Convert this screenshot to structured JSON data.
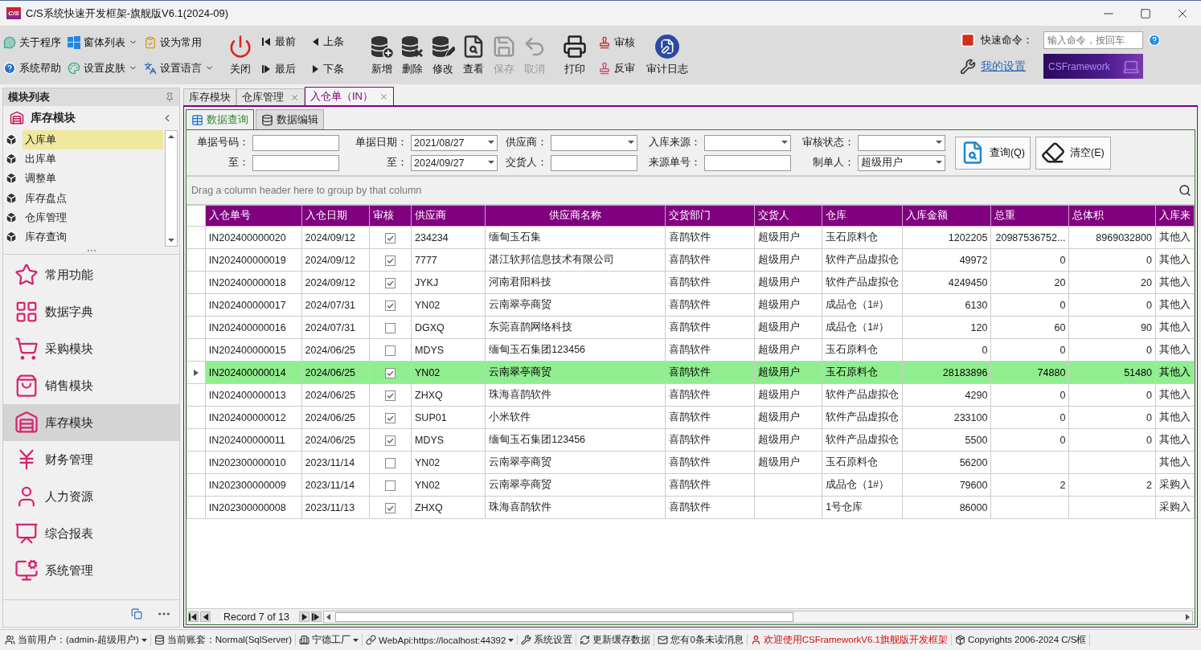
{
  "window": {
    "logo": "C/S",
    "title": "C/S系统快速开发框架-旗舰版V6.1(2024-09)"
  },
  "ribbon": {
    "quick_buttons": [
      {
        "label": "关于程序",
        "dropdown": false
      },
      {
        "label": "窗体列表",
        "dropdown": true
      },
      {
        "label": "设为常用",
        "dropdown": false
      },
      {
        "label": "系统帮助",
        "dropdown": false
      },
      {
        "label": "设置皮肤",
        "dropdown": true
      },
      {
        "label": "设置语言",
        "dropdown": true
      }
    ],
    "close_button": "关闭",
    "nav_buttons": [
      "最前",
      "上条",
      "最后",
      "下条"
    ],
    "action_buttons": [
      {
        "label": "新增",
        "disabled": false
      },
      {
        "label": "删除",
        "disabled": false
      },
      {
        "label": "修改",
        "disabled": false
      },
      {
        "label": "查看",
        "disabled": false
      },
      {
        "label": "保存",
        "disabled": true
      },
      {
        "label": "取消",
        "disabled": true
      },
      {
        "label": "打印",
        "disabled": false
      }
    ],
    "audit_buttons": [
      "审核",
      "反审"
    ],
    "log_button": "审计日志",
    "quick_command": {
      "label": "快速命令：",
      "placeholder": "输入命令，按回车"
    },
    "settings_link": "我的设置",
    "banner": "CSFramework"
  },
  "module_panel": {
    "title": "模块列表",
    "module": "库存模块",
    "items": [
      {
        "label": "入库单",
        "selected": true
      },
      {
        "label": "出库单",
        "selected": false
      },
      {
        "label": "调整单",
        "selected": false
      },
      {
        "label": "库存盘点",
        "selected": false
      },
      {
        "label": "仓库管理",
        "selected": false
      },
      {
        "label": "库存查询",
        "selected": false
      }
    ],
    "groups": [
      {
        "label": "常用功能",
        "selected": false
      },
      {
        "label": "数据字典",
        "selected": false
      },
      {
        "label": "采购模块",
        "selected": false
      },
      {
        "label": "销售模块",
        "selected": false
      },
      {
        "label": "库存模块",
        "selected": true
      },
      {
        "label": "财务管理",
        "selected": false
      },
      {
        "label": "人力资源",
        "selected": false
      },
      {
        "label": "综合报表",
        "selected": false
      },
      {
        "label": "系统管理",
        "selected": false
      }
    ]
  },
  "document_tabs": [
    {
      "label": "库存模块",
      "closable": false,
      "selected": false
    },
    {
      "label": "仓库管理",
      "closable": true,
      "selected": false
    },
    {
      "label": "入仓单（IN）",
      "closable": true,
      "selected": true
    }
  ],
  "view_tabs": [
    {
      "label": "数据查询",
      "selected": true
    },
    {
      "label": "数据编辑",
      "selected": false
    }
  ],
  "filters": [
    {
      "label": "单据号码：",
      "kind": "text"
    },
    {
      "label": "单据日期：",
      "kind": "dropdown",
      "value": "2021/08/27"
    },
    {
      "label": "供应商：",
      "kind": "dropdown"
    },
    {
      "label": "入库来源：",
      "kind": "dropdown"
    },
    {
      "label": "审核状态：",
      "kind": "dropdown"
    },
    {
      "label": "至：",
      "kind": "text"
    },
    {
      "label": "至：",
      "kind": "dropdown",
      "value": "2024/09/27"
    },
    {
      "label": "交货人：",
      "kind": "text"
    },
    {
      "label": "来源单号：",
      "kind": "text"
    },
    {
      "label": "制单人：",
      "kind": "dropdown",
      "value": "超级用户"
    }
  ],
  "filter_buttons": [
    "查询(Q)",
    "清空(E)"
  ],
  "group_panel_hint": "Drag a column header here to group by that column",
  "table": {
    "columns": [
      {
        "label": "入仓单号",
        "kind": "text"
      },
      {
        "label": "入仓日期",
        "kind": "text"
      },
      {
        "label": "审核",
        "kind": "check"
      },
      {
        "label": "供应商",
        "kind": "text"
      },
      {
        "label": "供应商名称",
        "kind": "text"
      },
      {
        "label": "交货部门",
        "kind": "text"
      },
      {
        "label": "交货人",
        "kind": "text"
      },
      {
        "label": "仓库",
        "kind": "text"
      },
      {
        "label": "入库金额",
        "kind": "number"
      },
      {
        "label": "总重",
        "kind": "number"
      },
      {
        "label": "总体积",
        "kind": "number"
      },
      {
        "label": "入库来",
        "kind": "text"
      }
    ],
    "rows": [
      {
        "selected": false,
        "cells": [
          "IN202400000020",
          "2024/09/12",
          true,
          "234234",
          "缅甸玉石集",
          "喜鹊软件",
          "超级用户",
          "玉石原料仓",
          "1202205",
          "20987536752...",
          "8969032800",
          "其他入"
        ]
      },
      {
        "selected": false,
        "cells": [
          "IN202400000019",
          "2024/09/12",
          true,
          "7777",
          "湛江软邦信息技术有限公司",
          "喜鹊软件",
          "超级用户",
          "软件产品虚拟仓",
          "49972",
          "0",
          "0",
          "其他入"
        ]
      },
      {
        "selected": false,
        "cells": [
          "IN202400000018",
          "2024/09/12",
          true,
          "JYKJ",
          "河南君阳科技",
          "喜鹊软件",
          "超级用户",
          "软件产品虚拟仓",
          "4249450",
          "20",
          "20",
          "其他入"
        ]
      },
      {
        "selected": false,
        "cells": [
          "IN202400000017",
          "2024/07/31",
          true,
          "YN02",
          "云南翠亭商贸",
          "喜鹊软件",
          "超级用户",
          "成品仓（1#）",
          "6130",
          "0",
          "0",
          "其他入"
        ]
      },
      {
        "selected": false,
        "cells": [
          "IN202400000016",
          "2024/07/31",
          false,
          "DGXQ",
          "东莞喜鹊网络科技",
          "喜鹊软件",
          "超级用户",
          "成品仓（1#）",
          "120",
          "60",
          "90",
          "其他入"
        ]
      },
      {
        "selected": false,
        "cells": [
          "IN202400000015",
          "2024/06/25",
          false,
          "MDYS",
          "缅甸玉石集团123456",
          "喜鹊软件",
          "超级用户",
          "玉石原料仓",
          "0",
          "0",
          "0",
          "其他入"
        ]
      },
      {
        "selected": true,
        "cells": [
          "IN202400000014",
          "2024/06/25",
          true,
          "YN02",
          "云南翠亭商贸",
          "喜鹊软件",
          "超级用户",
          "玉石原料仓",
          "28183896",
          "74880",
          "51480",
          "其他入"
        ]
      },
      {
        "selected": false,
        "cells": [
          "IN202400000013",
          "2024/06/25",
          true,
          "ZHXQ",
          "珠海喜鹊软件",
          "喜鹊软件",
          "超级用户",
          "软件产品虚拟仓",
          "4290",
          "0",
          "0",
          "其他入"
        ]
      },
      {
        "selected": false,
        "cells": [
          "IN202400000012",
          "2024/06/25",
          true,
          "SUP01",
          "小米软件",
          "喜鹊软件",
          "超级用户",
          "软件产品虚拟仓",
          "233100",
          "0",
          "0",
          "其他入"
        ]
      },
      {
        "selected": false,
        "cells": [
          "IN202400000011",
          "2024/06/25",
          true,
          "MDYS",
          "缅甸玉石集团123456",
          "喜鹊软件",
          "超级用户",
          "软件产品虚拟仓",
          "5500",
          "0",
          "0",
          "其他入"
        ]
      },
      {
        "selected": false,
        "cells": [
          "IN202300000010",
          "2023/11/14",
          false,
          "YN02",
          "云南翠亭商贸",
          "喜鹊软件",
          "超级用户",
          "玉石原料仓",
          "56200",
          null,
          null,
          "其他入"
        ]
      },
      {
        "selected": false,
        "cells": [
          "IN202300000009",
          "2023/11/14",
          false,
          "YN02",
          "云南翠亭商贸",
          "喜鹊软件",
          null,
          "成品仓（1#）",
          "79600",
          "2",
          "2",
          "采购入"
        ]
      },
      {
        "selected": false,
        "cells": [
          "IN202300000008",
          "2023/11/13",
          true,
          "ZHXQ",
          "珠海喜鹊软件",
          "喜鹊软件",
          null,
          "1号仓库",
          "86000",
          null,
          null,
          "采购入"
        ]
      }
    ]
  },
  "navigator": {
    "record": "Record 7 of 13"
  },
  "status_bar": [
    {
      "text": "当前用户：(admin-超级用户)",
      "dropdown": true,
      "kind": "plain"
    },
    {
      "text": "当前账套：Normal(SqlServer)",
      "dropdown": false,
      "kind": "plain"
    },
    {
      "text": "宁德工厂",
      "dropdown": true,
      "kind": "plain"
    },
    {
      "text": "WebApi:https://localhost:44392",
      "dropdown": true,
      "kind": "plain"
    },
    {
      "text": "系统设置",
      "dropdown": false,
      "kind": "plain"
    },
    {
      "text": "更新缓存数据",
      "dropdown": false,
      "kind": "plain"
    },
    {
      "text": "您有0条未读消息",
      "dropdown": false,
      "kind": "plain"
    },
    {
      "text": "欢迎使用CSFrameworkV6.1旗舰版开发框架",
      "dropdown": false,
      "kind": "notice"
    },
    {
      "text": "Copyrights 2006-2024 C/S框",
      "dropdown": false,
      "kind": "plain"
    }
  ]
}
